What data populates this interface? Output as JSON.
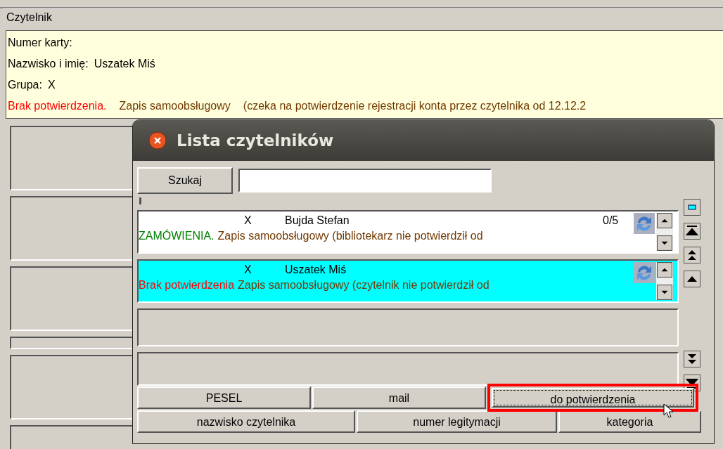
{
  "reader": {
    "group_title": "Czytelnik",
    "lines": [
      {
        "label": "Numer karty:"
      },
      {
        "label": "Nazwisko i imię:",
        "value": "Uszatek Miś"
      },
      {
        "label": "Grupa:",
        "value": "X"
      }
    ],
    "status": [
      {
        "text": "Brak potwierdzenia.",
        "color": "#ff0000"
      },
      {
        "text": "Zapis samoobsługowy",
        "color": "#703800"
      },
      {
        "text": "(czeka na potwierdzenie rejestracji konta przez czytelnika od 12.12.2",
        "color": "#703800"
      }
    ]
  },
  "dialog": {
    "title": "Lista czytelników",
    "search_button": "Szukaj",
    "rows": [
      {
        "group": "X",
        "name": "Bujda Stefan",
        "count": "0/5",
        "selected": false,
        "status": [
          {
            "text": "ZAMÓWIENIA.",
            "color": "#008000"
          },
          {
            "text": "Zapis samoobsługowy  (bibliotekarz nie potwierdził od",
            "color": "#703800"
          }
        ]
      },
      {
        "group": "X",
        "name": "Uszatek Miś",
        "selected": true,
        "status": [
          {
            "text": "Brak potwierdzenia",
            "color": "#ff0000"
          },
          {
            "text": "Zapis samoobsługowy  (czytelnik nie potwierdził od",
            "color": "#703800"
          }
        ]
      }
    ],
    "sort_rows": [
      [
        {
          "label": "PESEL",
          "focused": false
        },
        {
          "label": "mail",
          "focused": false
        },
        {
          "label": "do potwierdzenia",
          "focused": true
        }
      ],
      [
        {
          "label": "nazwisko czytelnika",
          "focused": false
        },
        {
          "label": "numer legitymacji",
          "focused": false
        },
        {
          "label": "kategoria",
          "focused": false
        }
      ]
    ]
  }
}
